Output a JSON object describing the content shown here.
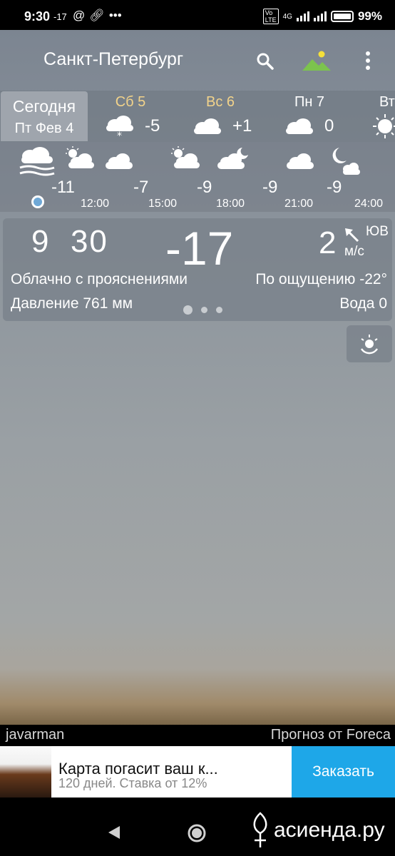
{
  "status_bar": {
    "time": "9:30",
    "temp": "-17",
    "battery": "99%",
    "network": "4G"
  },
  "header": {
    "city": "Санкт-Петербург"
  },
  "days": {
    "today": {
      "label": "Сегодня",
      "date": "Пт Фев 4"
    },
    "items": [
      {
        "name": "Сб 5",
        "temp": "-5",
        "icon": "snow-cloud-icon",
        "color": "#f2d38a"
      },
      {
        "name": "Вс 6",
        "temp": "+1",
        "icon": "cloud-icon",
        "color": "#f2d38a"
      },
      {
        "name": "Пн 7",
        "temp": "0",
        "icon": "cloud-icon",
        "color": "#ffffff"
      },
      {
        "name": "Вт",
        "temp": "",
        "icon": "sun-icon",
        "color": "#ffffff"
      }
    ]
  },
  "hourly": {
    "temps": [
      "-11",
      "-7",
      "-9",
      "-9",
      "-9"
    ],
    "times": [
      "12:00",
      "15:00",
      "18:00",
      "21:00",
      "24:00"
    ]
  },
  "current": {
    "time_h": "9",
    "time_m": "30",
    "temp": "-17",
    "wind_speed": "2",
    "wind_dir": "ЮВ",
    "wind_unit": "м/с",
    "condition": "Облачно с прояснениями",
    "feels_like": "По ощущению -22°",
    "pressure": "Давление 761 мм",
    "water": "Вода 0"
  },
  "credits": {
    "author": "javarman",
    "source": "Прогноз от Foreca"
  },
  "ad": {
    "title": "Карта погасит ваш к...",
    "subtitle": "120 дней. Ставка от 12%",
    "cta": "Заказать"
  },
  "watermark": "асиенда.ру"
}
